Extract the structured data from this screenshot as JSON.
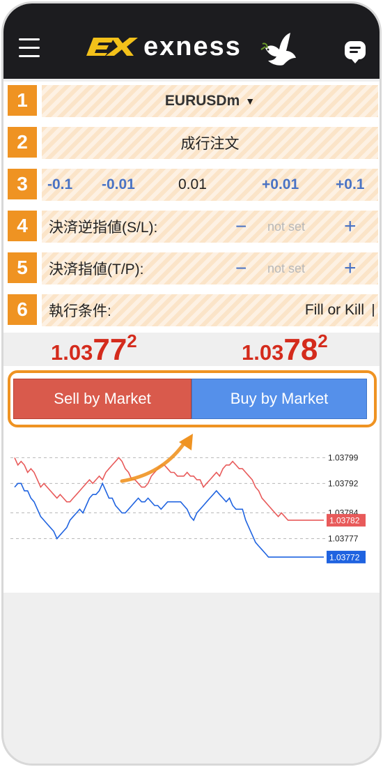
{
  "header": {
    "brand": "exness",
    "logo_mark": "𝑒𝑥",
    "menu_icon": "hamburger-icon",
    "chat_icon": "chat-icon",
    "dove_icon": "dove-icon"
  },
  "rows": {
    "r1": {
      "num": "1",
      "symbol": "EURUSDm",
      "caret": "▼"
    },
    "r2": {
      "num": "2",
      "label": "成行注文"
    },
    "r3": {
      "num": "3",
      "btn_m01": "-0.1",
      "btn_m001": "-0.01",
      "value": "0.01",
      "btn_p001": "+0.01",
      "btn_p01": "+0.1"
    },
    "r4": {
      "num": "4",
      "label": "決済逆指値(S/L):",
      "minus": "−",
      "value": "not set",
      "plus": "+"
    },
    "r5": {
      "num": "5",
      "label": "決済指値(T/P):",
      "minus": "−",
      "value": "not set",
      "plus": "+"
    },
    "r6": {
      "num": "6",
      "label": "執行条件:",
      "value": "Fill or Kill"
    }
  },
  "prices": {
    "sell": {
      "prefix": "1.03",
      "big": "77",
      "sup": "2"
    },
    "buy": {
      "prefix": "1.03",
      "big": "78",
      "sup": "2"
    }
  },
  "actions": {
    "sell_label": "Sell by Market",
    "buy_label": "Buy by Market"
  },
  "colors": {
    "accent": "#ef9322",
    "sell": "#d95a4c",
    "buy": "#5590ea",
    "price": "#d42b1c"
  },
  "chart_data": {
    "type": "line",
    "ylim": [
      1.03768,
      1.03804
    ],
    "y_ticks": [
      "1.03799",
      "1.03792",
      "1.03784",
      "1.03777"
    ],
    "series": [
      {
        "color": "#e85a5a",
        "values": [
          1.03799,
          1.03797,
          1.03798,
          1.03797,
          1.03795,
          1.03796,
          1.03795,
          1.03793,
          1.03791,
          1.03792,
          1.03791,
          1.0379,
          1.03789,
          1.03788,
          1.03789,
          1.03788,
          1.03787,
          1.03787,
          1.03788,
          1.03789,
          1.0379,
          1.03791,
          1.03792,
          1.03793,
          1.03792,
          1.03793,
          1.03794,
          1.03793,
          1.03795,
          1.03796,
          1.03797,
          1.03798,
          1.03799,
          1.03798,
          1.03796,
          1.03795,
          1.03793,
          1.03793,
          1.03792,
          1.03791,
          1.03791,
          1.03792,
          1.03794,
          1.03795,
          1.03796,
          1.03797,
          1.03797,
          1.03796,
          1.03795,
          1.03795,
          1.03794,
          1.03794,
          1.03794,
          1.03795,
          1.03794,
          1.03794,
          1.03793,
          1.03793,
          1.03791,
          1.03792,
          1.03793,
          1.03794,
          1.03795,
          1.03794,
          1.03796,
          1.03797,
          1.03797,
          1.03798,
          1.03797,
          1.03796,
          1.03796,
          1.03795,
          1.03794,
          1.03793,
          1.03791,
          1.0379,
          1.03788,
          1.03787,
          1.03786,
          1.03785,
          1.03784,
          1.03783,
          1.03784,
          1.03783,
          1.03782,
          1.03782,
          1.03782,
          1.03782,
          1.03782,
          1.03782,
          1.03782,
          1.03782,
          1.03782,
          1.03782,
          1.03782,
          1.03782
        ]
      },
      {
        "color": "#1f63e0",
        "values": [
          1.03791,
          1.03792,
          1.03792,
          1.0379,
          1.0379,
          1.03788,
          1.03787,
          1.03785,
          1.03783,
          1.03782,
          1.03781,
          1.0378,
          1.03779,
          1.03777,
          1.03778,
          1.03779,
          1.0378,
          1.03782,
          1.03783,
          1.03784,
          1.03785,
          1.03784,
          1.03786,
          1.03788,
          1.03789,
          1.03789,
          1.0379,
          1.03792,
          1.0379,
          1.03788,
          1.03788,
          1.03786,
          1.03785,
          1.03784,
          1.03784,
          1.03785,
          1.03786,
          1.03787,
          1.03788,
          1.03787,
          1.03787,
          1.03788,
          1.03787,
          1.03786,
          1.03786,
          1.03785,
          1.03786,
          1.03787,
          1.03787,
          1.03787,
          1.03787,
          1.03787,
          1.03786,
          1.03785,
          1.03783,
          1.03782,
          1.03784,
          1.03785,
          1.03786,
          1.03787,
          1.03788,
          1.03789,
          1.0379,
          1.03789,
          1.03788,
          1.03787,
          1.03788,
          1.03786,
          1.03785,
          1.03785,
          1.03785,
          1.03782,
          1.0378,
          1.03778,
          1.03776,
          1.03775,
          1.03774,
          1.03773,
          1.03772,
          1.03772,
          1.03772,
          1.03772,
          1.03772,
          1.03772,
          1.03772,
          1.03772,
          1.03772,
          1.03772,
          1.03772,
          1.03772,
          1.03772,
          1.03772,
          1.03772,
          1.03772,
          1.03772,
          1.03772
        ]
      }
    ],
    "last_labels": [
      "1.03782",
      "1.03772"
    ]
  }
}
